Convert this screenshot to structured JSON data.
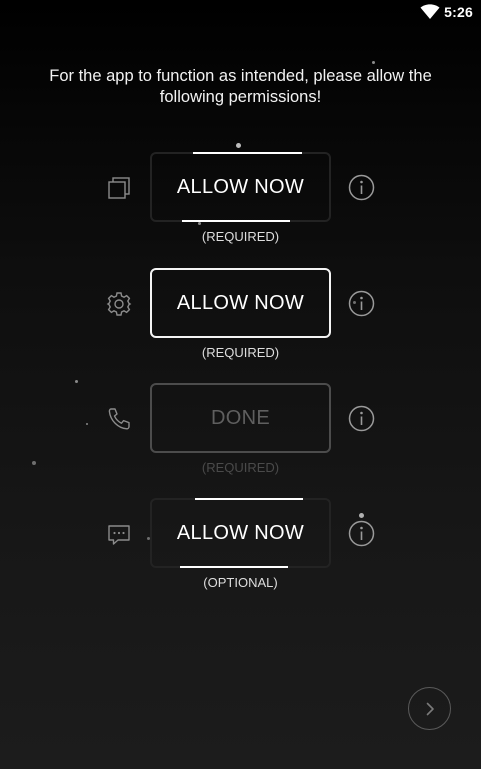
{
  "status_bar": {
    "time": "5:26",
    "wifi_icon": "wifi-icon"
  },
  "intro": {
    "text": "For the app to function as intended, please allow the following permissions!"
  },
  "permissions": [
    {
      "icon": "overlay-windows-icon",
      "button_label": "ALLOW NOW",
      "requirement": "(REQUIRED)",
      "info_icon": "info-icon"
    },
    {
      "icon": "settings-gear-icon",
      "button_label": "ALLOW NOW",
      "requirement": "(REQUIRED)",
      "info_icon": "info-icon"
    },
    {
      "icon": "phone-icon",
      "button_label": "DONE",
      "requirement": "(REQUIRED)",
      "info_icon": "info-icon"
    },
    {
      "icon": "sms-message-icon",
      "button_label": "ALLOW NOW",
      "requirement": "(OPTIONAL)",
      "info_icon": "info-icon"
    }
  ],
  "next_button": {
    "icon": "chevron-right-icon"
  },
  "colors": {
    "background_top": "#000000",
    "background_bottom": "#1c1c1c",
    "text": "#ffffff",
    "done_text": "#5f5f5f",
    "active_border": "#f4f4f4"
  }
}
